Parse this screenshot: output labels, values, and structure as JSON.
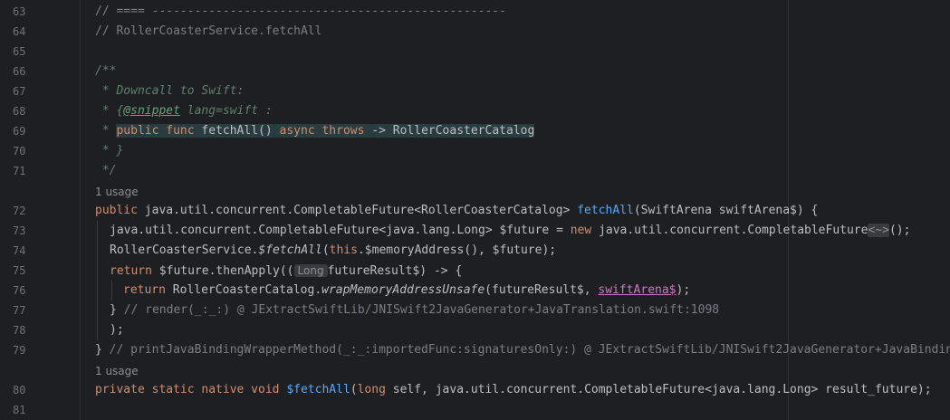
{
  "editor": {
    "line_numbers": {
      "l63": "63",
      "l64": "64",
      "l65": "65",
      "l66": "66",
      "l67": "67",
      "l68": "68",
      "l69": "69",
      "l70": "70",
      "l71": "71",
      "l72": "72",
      "l73": "73",
      "l74": "74",
      "l75": "75",
      "l76": "76",
      "l77": "77",
      "l78": "78",
      "l79": "79",
      "l80": "80",
      "l81": "81"
    },
    "usage_hint_1": "1 usage",
    "usage_hint_2": "1 usage",
    "line63": "// ==== --------------------------------------------------",
    "line64": "// RollerCoasterService.fetchAll",
    "line66": "/**",
    "line67": " * Downcall to Swift:",
    "line68": {
      "prefix": " * {",
      "snippet_tag": "@snippet",
      "rest": " lang=swift :"
    },
    "line69": {
      "prefix": " * ",
      "code": {
        "t1": "public",
        "t2": " ",
        "t3": "func",
        "t4": " fetchAll() ",
        "t5": "async",
        "t6": " ",
        "t7": "throws",
        "t8": " -> RollerCoasterCatalog"
      }
    },
    "line70": " * }",
    "line71": " */",
    "line72": {
      "kw": "public",
      "type": " java.util.concurrent.CompletableFuture<RollerCoasterCatalog> ",
      "fn": "fetchAll",
      "rest": "(SwiftArena swiftArena$) {"
    },
    "line73": {
      "a": "java.util.concurrent.CompletableFuture<java.lang.Long> $future = ",
      "kw": "new",
      "b": " java.util.concurrent.CompletableFuture",
      "diamond": "<~>",
      "c": "();"
    },
    "line74": {
      "a": "RollerCoasterService.",
      "method": "$fetchAll",
      "b": "(",
      "kw": "this",
      "c": ".$memoryAddress(), $future);"
    },
    "line75": {
      "kw": "return",
      "a": " $future.thenApply((",
      "inlay": "Long",
      "b": "futureResult$) -> {"
    },
    "line76": {
      "kw": "return",
      "a": " RollerCoasterCatalog.",
      "method": "wrapMemoryAddressUnsafe",
      "b": "(futureResult$, ",
      "link": "swiftArena$",
      "c": ");"
    },
    "line77": {
      "a": "} ",
      "comment": "// render(_:_:) @ JExtractSwiftLib/JNISwift2JavaGenerator+JavaTranslation.swift:1098"
    },
    "line78": ");",
    "line79": {
      "a": "} ",
      "comment": "// printJavaBindingWrapperMethod(_:_:importedFunc:signaturesOnly:) @ JExtractSwiftLib/JNISwift2JavaGenerator+JavaBindin"
    },
    "line80": {
      "kw": "private static native void",
      "sp": " ",
      "fn": "$fetchAll",
      "a": "(",
      "kw2": "long",
      "b": " self, java.util.concurrent.CompletableFuture<java.lang.Long> result_future);"
    }
  }
}
